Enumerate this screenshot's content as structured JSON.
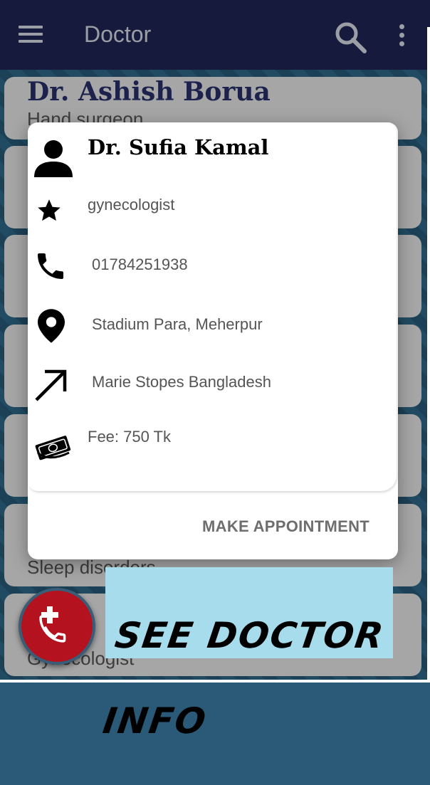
{
  "app_bar": {
    "title": "Doctor",
    "menu_icon": "hamburger-menu-icon",
    "search_icon": "search-icon",
    "more_icon": "more-vert-icon",
    "color": "#1f2657"
  },
  "list": {
    "items": [
      {
        "name": "Dr. Ashish Borua",
        "specialty": "Hand surgeon"
      },
      {
        "name": "",
        "specialty": ""
      },
      {
        "name": "",
        "specialty": ""
      },
      {
        "name": "",
        "specialty": ""
      },
      {
        "name": "",
        "specialty": ""
      },
      {
        "name": "",
        "specialty": "Sleep disorders"
      },
      {
        "name": "",
        "specialty": "Gynecologist"
      }
    ]
  },
  "dialog": {
    "name": "Dr. Sufia Kamal",
    "specialty": "gynecologist",
    "phone": "01784251938",
    "location": "Stadium Para, Meherpur",
    "organization": "Marie Stopes Bangladesh",
    "fee": "Fee: 750 Tk",
    "action_label": "MAKE APPOINTMENT",
    "icons": {
      "name": "person-icon",
      "specialty": "star-icon",
      "phone": "phone-icon",
      "location": "location-pin-icon",
      "organization": "arrow-up-right-icon",
      "fee": "money-icon"
    }
  },
  "fab": {
    "icon": "emergency-call-icon",
    "color": "#b3121e"
  },
  "banner": {
    "line1": "SEE DOCTOR",
    "line2": "INFO",
    "color": "#a6dceb"
  }
}
